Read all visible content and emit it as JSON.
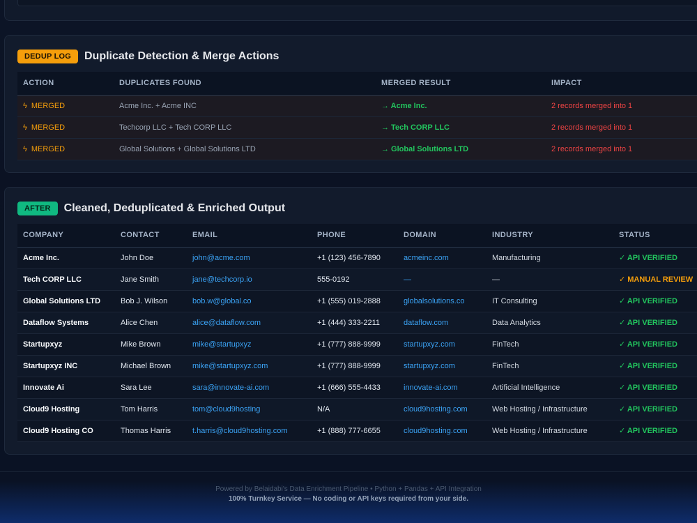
{
  "dedup": {
    "badge": "DEDUP LOG",
    "title": "Duplicate Detection & Merge Actions",
    "columns": [
      "ACTION",
      "DUPLICATES FOUND",
      "MERGED RESULT",
      "IMPACT"
    ],
    "rows": [
      {
        "action": "MERGED",
        "duplicates": "Acme Inc. + Acme INC",
        "result": "→ Acme Inc.",
        "impact": "2 records merged into 1"
      },
      {
        "action": "MERGED",
        "duplicates": "Techcorp LLC + Tech CORP LLC",
        "result": "→ Tech CORP LLC",
        "impact": "2 records merged into 1"
      },
      {
        "action": "MERGED",
        "duplicates": "Global Solutions + Global Solutions LTD",
        "result": "→ Global Solutions LTD",
        "impact": "2 records merged into 1"
      }
    ],
    "action_icon": "lightning-bolt-icon"
  },
  "output": {
    "badge": "AFTER",
    "title": "Cleaned, Deduplicated & Enriched Output",
    "columns": [
      "COMPANY",
      "CONTACT",
      "EMAIL",
      "PHONE",
      "DOMAIN",
      "INDUSTRY",
      "STATUS"
    ],
    "rows": [
      {
        "company": "Acme Inc.",
        "contact": "John Doe",
        "email": "john@acme.com",
        "phone": "+1 (123) 456-7890",
        "domain": "acmeinc.com",
        "industry": "Manufacturing",
        "status": "✓ API VERIFIED"
      },
      {
        "company": "Tech CORP LLC",
        "contact": "Jane Smith",
        "email": "jane@techcorp.io",
        "phone": "555-0192",
        "domain": "—",
        "industry": "—",
        "status": "✓ MANUAL REVIEW"
      },
      {
        "company": "Global Solutions LTD",
        "contact": "Bob J. Wilson",
        "email": "bob.w@global.co",
        "phone": "+1 (555) 019-2888",
        "domain": "globalsolutions.co",
        "industry": "IT Consulting",
        "status": "✓ API VERIFIED"
      },
      {
        "company": "Dataflow Systems",
        "contact": "Alice Chen",
        "email": "alice@dataflow.com",
        "phone": "+1 (444) 333-2211",
        "domain": "dataflow.com",
        "industry": "Data Analytics",
        "status": "✓ API VERIFIED"
      },
      {
        "company": "Startupxyz",
        "contact": "Mike Brown",
        "email": "mike@startupxyz",
        "phone": "+1 (777) 888-9999",
        "domain": "startupxyz.com",
        "industry": "FinTech",
        "status": "✓ API VERIFIED"
      },
      {
        "company": "Startupxyz INC",
        "contact": "Michael Brown",
        "email": "mike@startupxyz.com",
        "phone": "+1 (777) 888-9999",
        "domain": "startupxyz.com",
        "industry": "FinTech",
        "status": "✓ API VERIFIED"
      },
      {
        "company": "Innovate Ai",
        "contact": "Sara Lee",
        "email": "sara@innovate-ai.com",
        "phone": "+1 (666) 555-4433",
        "domain": "innovate-ai.com",
        "industry": "Artificial Intelligence",
        "status": "✓ API VERIFIED"
      },
      {
        "company": "Cloud9 Hosting",
        "contact": "Tom Harris",
        "email": "tom@cloud9hosting",
        "phone": "N/A",
        "domain": "cloud9hosting.com",
        "industry": "Web Hosting / Infrastructure",
        "status": "✓ API VERIFIED"
      },
      {
        "company": "Cloud9 Hosting CO",
        "contact": "Thomas Harris",
        "email": "t.harris@cloud9hosting.com",
        "phone": "+1 (888) 777-6655",
        "domain": "cloud9hosting.com",
        "industry": "Web Hosting / Infrastructure",
        "status": "✓ API VERIFIED"
      }
    ]
  },
  "footer": {
    "line1": "Powered by Belaidabi's Data Enrichment Pipeline • Python + Pandas + API Integration",
    "line2": "100% Turnkey Service — No coding or API keys required from your side."
  },
  "colors": {
    "accent_orange": "#f59e0b",
    "accent_green": "#10b981",
    "link_blue": "#3ba3f5",
    "impact_red": "#ef4444"
  }
}
